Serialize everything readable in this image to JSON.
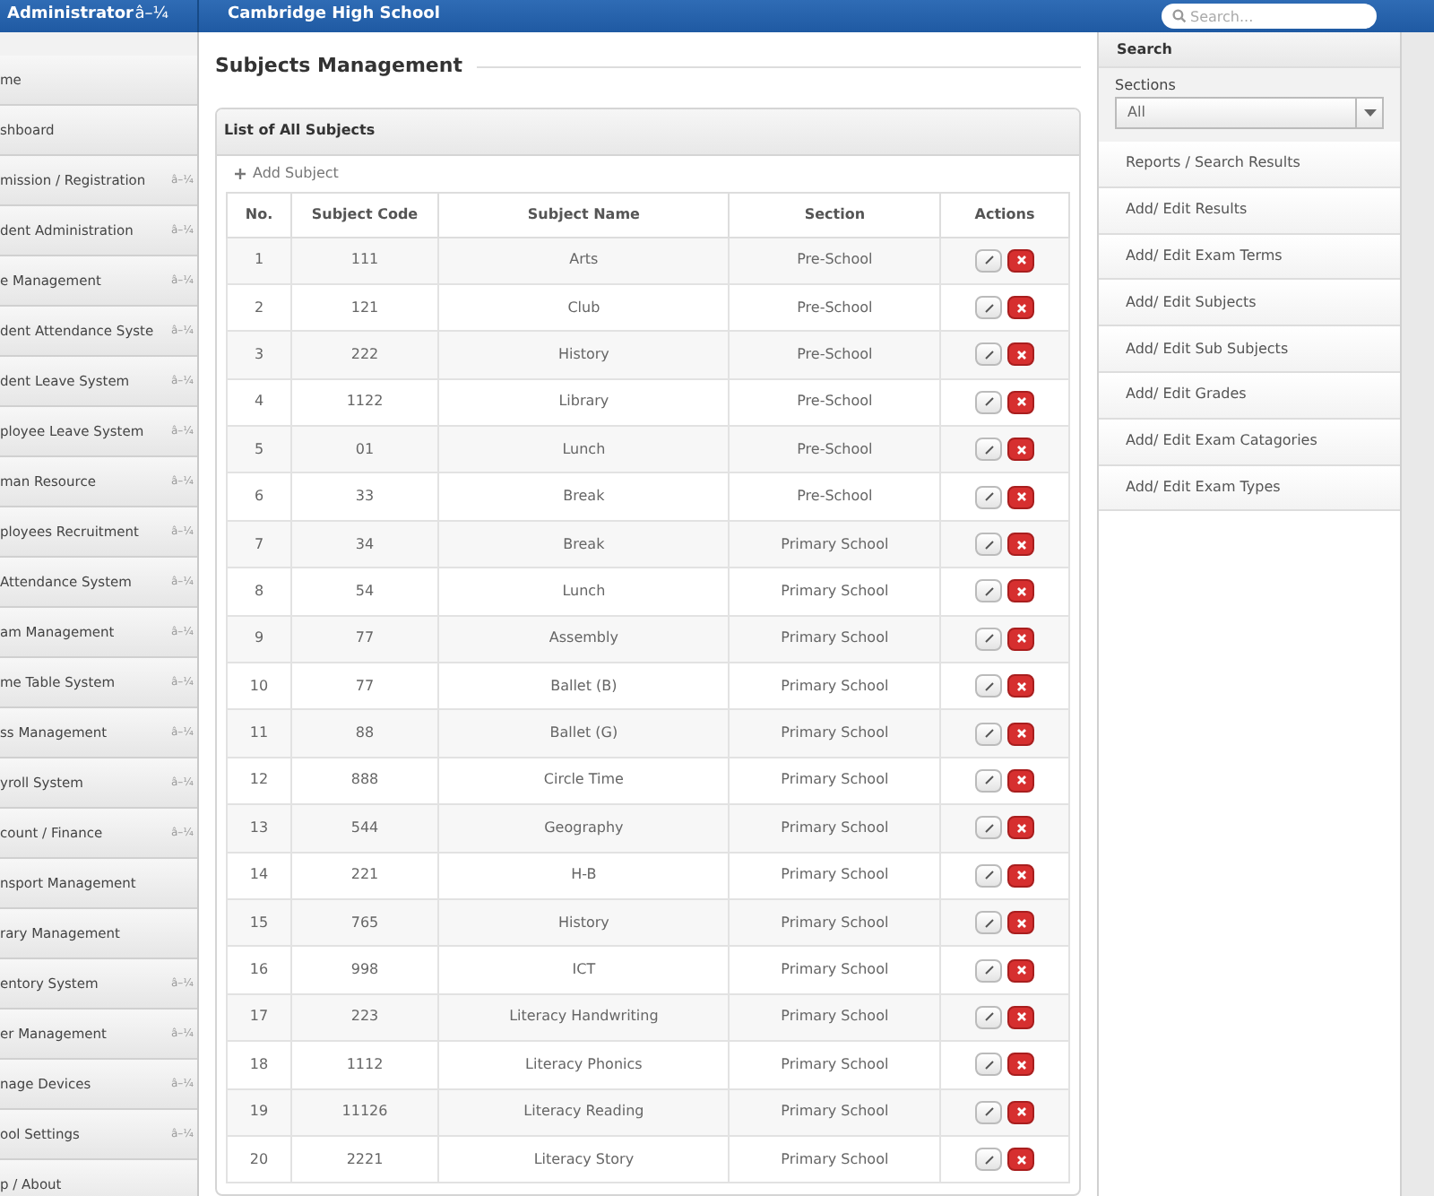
{
  "header": {
    "user": "Administrator",
    "user_caret": "â–¼",
    "school": "Cambridge High School",
    "search_placeholder": "Search..."
  },
  "sidebar": {
    "items": [
      {
        "label": "me"
      },
      {
        "label": "shboard"
      },
      {
        "label": "mission / Registration",
        "caret": "â–¼"
      },
      {
        "label": "dent Administration",
        "caret": "â–¼"
      },
      {
        "label": "e Management",
        "caret": "â–¼"
      },
      {
        "label": "dent Attendance Syste",
        "caret": "â–¼"
      },
      {
        "label": "dent Leave System",
        "caret": "â–¼"
      },
      {
        "label": "ployee Leave System",
        "caret": "â–¼"
      },
      {
        "label": "man Resource",
        "caret": "â–¼"
      },
      {
        "label": "ployees Recruitment",
        "caret": "â–¼"
      },
      {
        "label": "Attendance System",
        "caret": "â–¼"
      },
      {
        "label": "am Management",
        "caret": "â–¼"
      },
      {
        "label": "me Table System",
        "caret": "â–¼"
      },
      {
        "label": "ss Management",
        "caret": "â–¼"
      },
      {
        "label": "yroll System",
        "caret": "â–¼"
      },
      {
        "label": "count / Finance",
        "caret": "â–¼"
      },
      {
        "label": "nsport Management"
      },
      {
        "label": "rary Management"
      },
      {
        "label": "entory System",
        "caret": "â–¼"
      },
      {
        "label": "er Management",
        "caret": "â–¼"
      },
      {
        "label": "nage Devices",
        "caret": "â–¼"
      },
      {
        "label": "ool Settings",
        "caret": "â–¼"
      },
      {
        "label": "p / About"
      }
    ]
  },
  "page_title": "Subjects Management",
  "panel": {
    "title": "List of All Subjects",
    "add_button": "Add Subject",
    "table": {
      "columns": [
        "No.",
        "Subject Code",
        "Subject Name",
        "Section",
        "Actions"
      ],
      "rows": [
        [
          "1",
          "111",
          "Arts",
          "Pre-School"
        ],
        [
          "2",
          "121",
          "Club",
          "Pre-School"
        ],
        [
          "3",
          "222",
          "History",
          "Pre-School"
        ],
        [
          "4",
          "1122",
          "Library",
          "Pre-School"
        ],
        [
          "5",
          "01",
          "Lunch",
          "Pre-School"
        ],
        [
          "6",
          "33",
          "Break",
          "Pre-School"
        ],
        [
          "7",
          "34",
          "Break",
          "Primary School"
        ],
        [
          "8",
          "54",
          "Lunch",
          "Primary School"
        ],
        [
          "9",
          "77",
          "Assembly",
          "Primary School"
        ],
        [
          "10",
          "77",
          "Ballet (B)",
          "Primary School"
        ],
        [
          "11",
          "88",
          "Ballet (G)",
          "Primary School"
        ],
        [
          "12",
          "888",
          "Circle Time",
          "Primary School"
        ],
        [
          "13",
          "544",
          "Geography",
          "Primary School"
        ],
        [
          "14",
          "221",
          "H-B",
          "Primary School"
        ],
        [
          "15",
          "765",
          "History",
          "Primary School"
        ],
        [
          "16",
          "998",
          "ICT",
          "Primary School"
        ],
        [
          "17",
          "223",
          "Literacy Handwriting",
          "Primary School"
        ],
        [
          "18",
          "1112",
          "Literacy Phonics",
          "Primary School"
        ],
        [
          "19",
          "11126",
          "Literacy Reading",
          "Primary School"
        ],
        [
          "20",
          "2221",
          "Literacy Story",
          "Primary School"
        ]
      ]
    }
  },
  "right_panel": {
    "title": "Search",
    "sections_label": "Sections",
    "sections_value": "All",
    "links": [
      "Reports / Search Results",
      "Add/ Edit Results",
      "Add/ Edit Exam Terms",
      "Add/ Edit Subjects",
      "Add/ Edit Sub Subjects",
      "Add/ Edit Grades",
      "Add/ Edit Exam Catagories",
      "Add/ Edit Exam Types"
    ]
  }
}
